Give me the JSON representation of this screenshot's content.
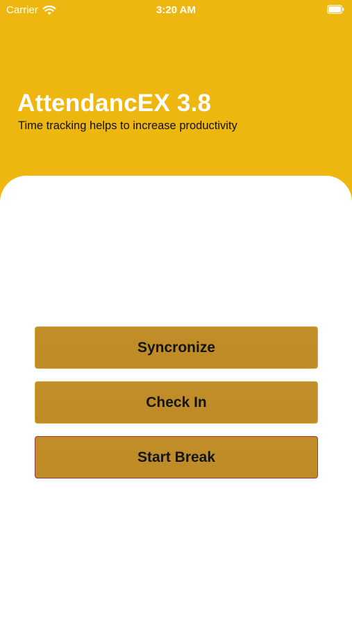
{
  "status_bar": {
    "carrier": "Carrier",
    "time": "3:20 AM",
    "wifi_icon": "wifi-icon",
    "battery_icon": "battery-icon"
  },
  "header": {
    "title": "AttendancEX 3.8",
    "subtitle": "Time tracking helps to increase productivity"
  },
  "actions": {
    "sync_label": "Syncronize",
    "checkin_label": "Check In",
    "break_label": "Start Break"
  },
  "colors": {
    "header_background": "#EEB70F",
    "button_background": "#BF8D27",
    "button_text": "#141414",
    "break_button_border": "#A2383E"
  }
}
